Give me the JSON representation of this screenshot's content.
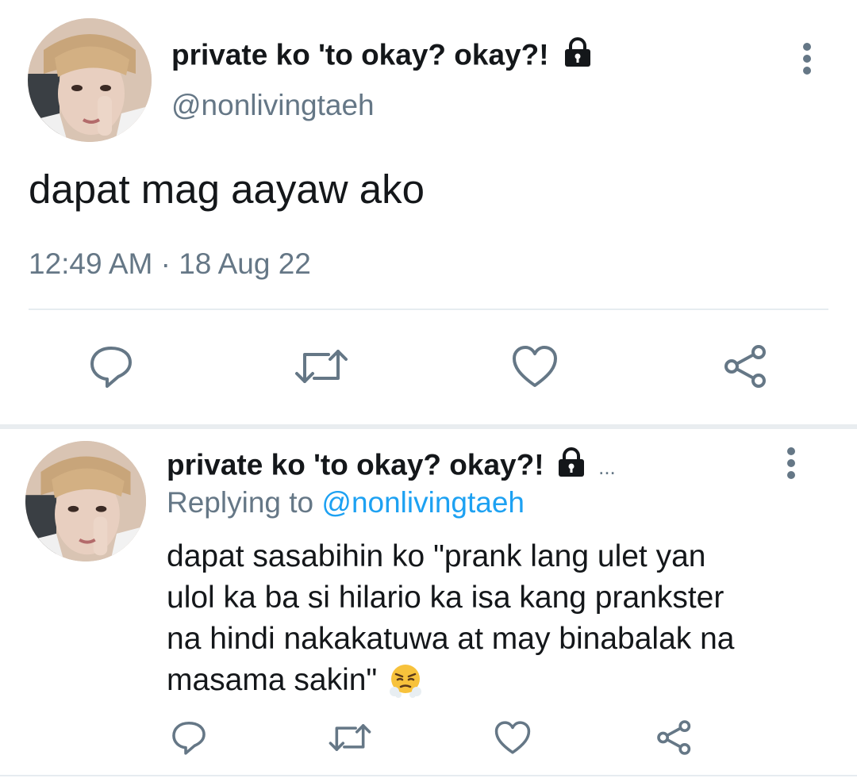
{
  "main_tweet": {
    "display_name": "private ko 'to okay? okay?!",
    "handle": "@nonlivingtaeh",
    "text": "dapat mag aayaw ako",
    "timestamp": "12:49 AM · 18 Aug 22",
    "locked_icon": "lock-icon",
    "actions": [
      "reply-icon",
      "retweet-icon",
      "like-icon",
      "share-icon"
    ]
  },
  "reply_tweet": {
    "display_name": "private ko 'to okay? okay?!",
    "ellipsis": "...",
    "replying_prefix": "Replying to",
    "replying_handle": "@nonlivingtaeh",
    "text_lines": [
      "dapat sasabihin ko \"prank lang ulet yan",
      "ulol ka ba si hilario ka isa kang prankster",
      "na hindi nakakatuwa at may binabalak na",
      "masama sakin\""
    ],
    "emoji": "😤",
    "actions": [
      "reply-icon",
      "retweet-icon",
      "like-icon",
      "share-icon"
    ]
  },
  "colors": {
    "icon": "#657786",
    "link": "#1da1f2",
    "divider": "#e6ecf0"
  }
}
